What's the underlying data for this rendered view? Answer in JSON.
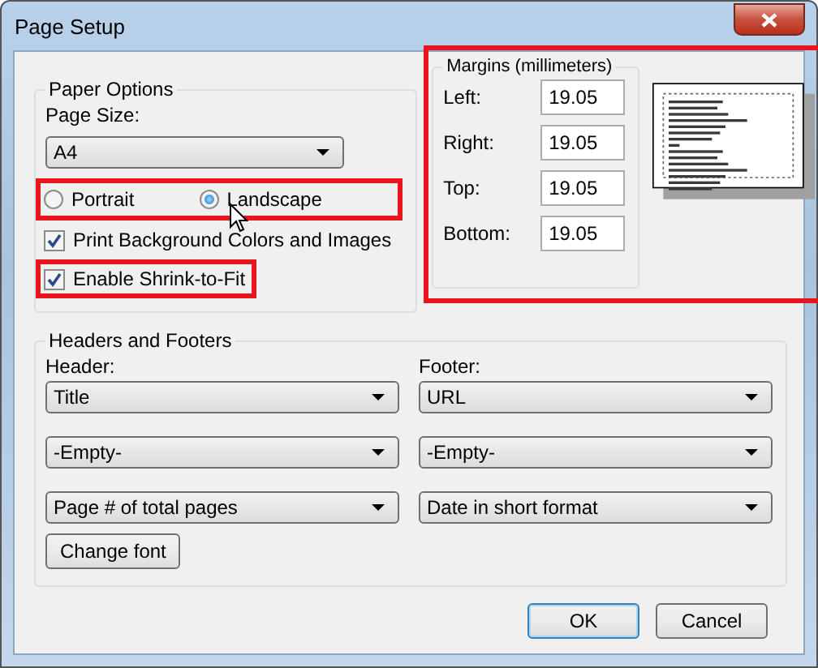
{
  "window": {
    "title": "Page Setup"
  },
  "paper_options": {
    "title": "Paper Options",
    "page_size_label": "Page Size:",
    "page_size": "A4",
    "orientation": {
      "highlighted": true,
      "options": [
        {
          "label": "Portrait",
          "selected": false
        },
        {
          "label": "Landscape",
          "selected": true
        }
      ]
    },
    "options": [
      {
        "label": "Print Background Colors and Images",
        "checked": true,
        "highlighted": false
      },
      {
        "label": "Enable Shrink-to-Fit",
        "checked": true,
        "highlighted": true
      }
    ]
  },
  "margins": {
    "title": "Margins (millimeters)",
    "highlighted": true,
    "fields": [
      {
        "label": "Left:",
        "value": "19.05"
      },
      {
        "label": "Right:",
        "value": "19.05"
      },
      {
        "label": "Top:",
        "value": "19.05"
      },
      {
        "label": "Bottom:",
        "value": "19.05"
      }
    ]
  },
  "headers_footers": {
    "title": "Headers and Footers",
    "header_label": "Header:",
    "footer_label": "Footer:",
    "header": [
      "Title",
      "-Empty-",
      "Page # of total pages"
    ],
    "footer": [
      "URL",
      "-Empty-",
      "Date in short format"
    ],
    "change_font": "Change font"
  },
  "buttons": [
    {
      "label": "OK",
      "default": true
    },
    {
      "label": "Cancel",
      "default": false
    }
  ]
}
